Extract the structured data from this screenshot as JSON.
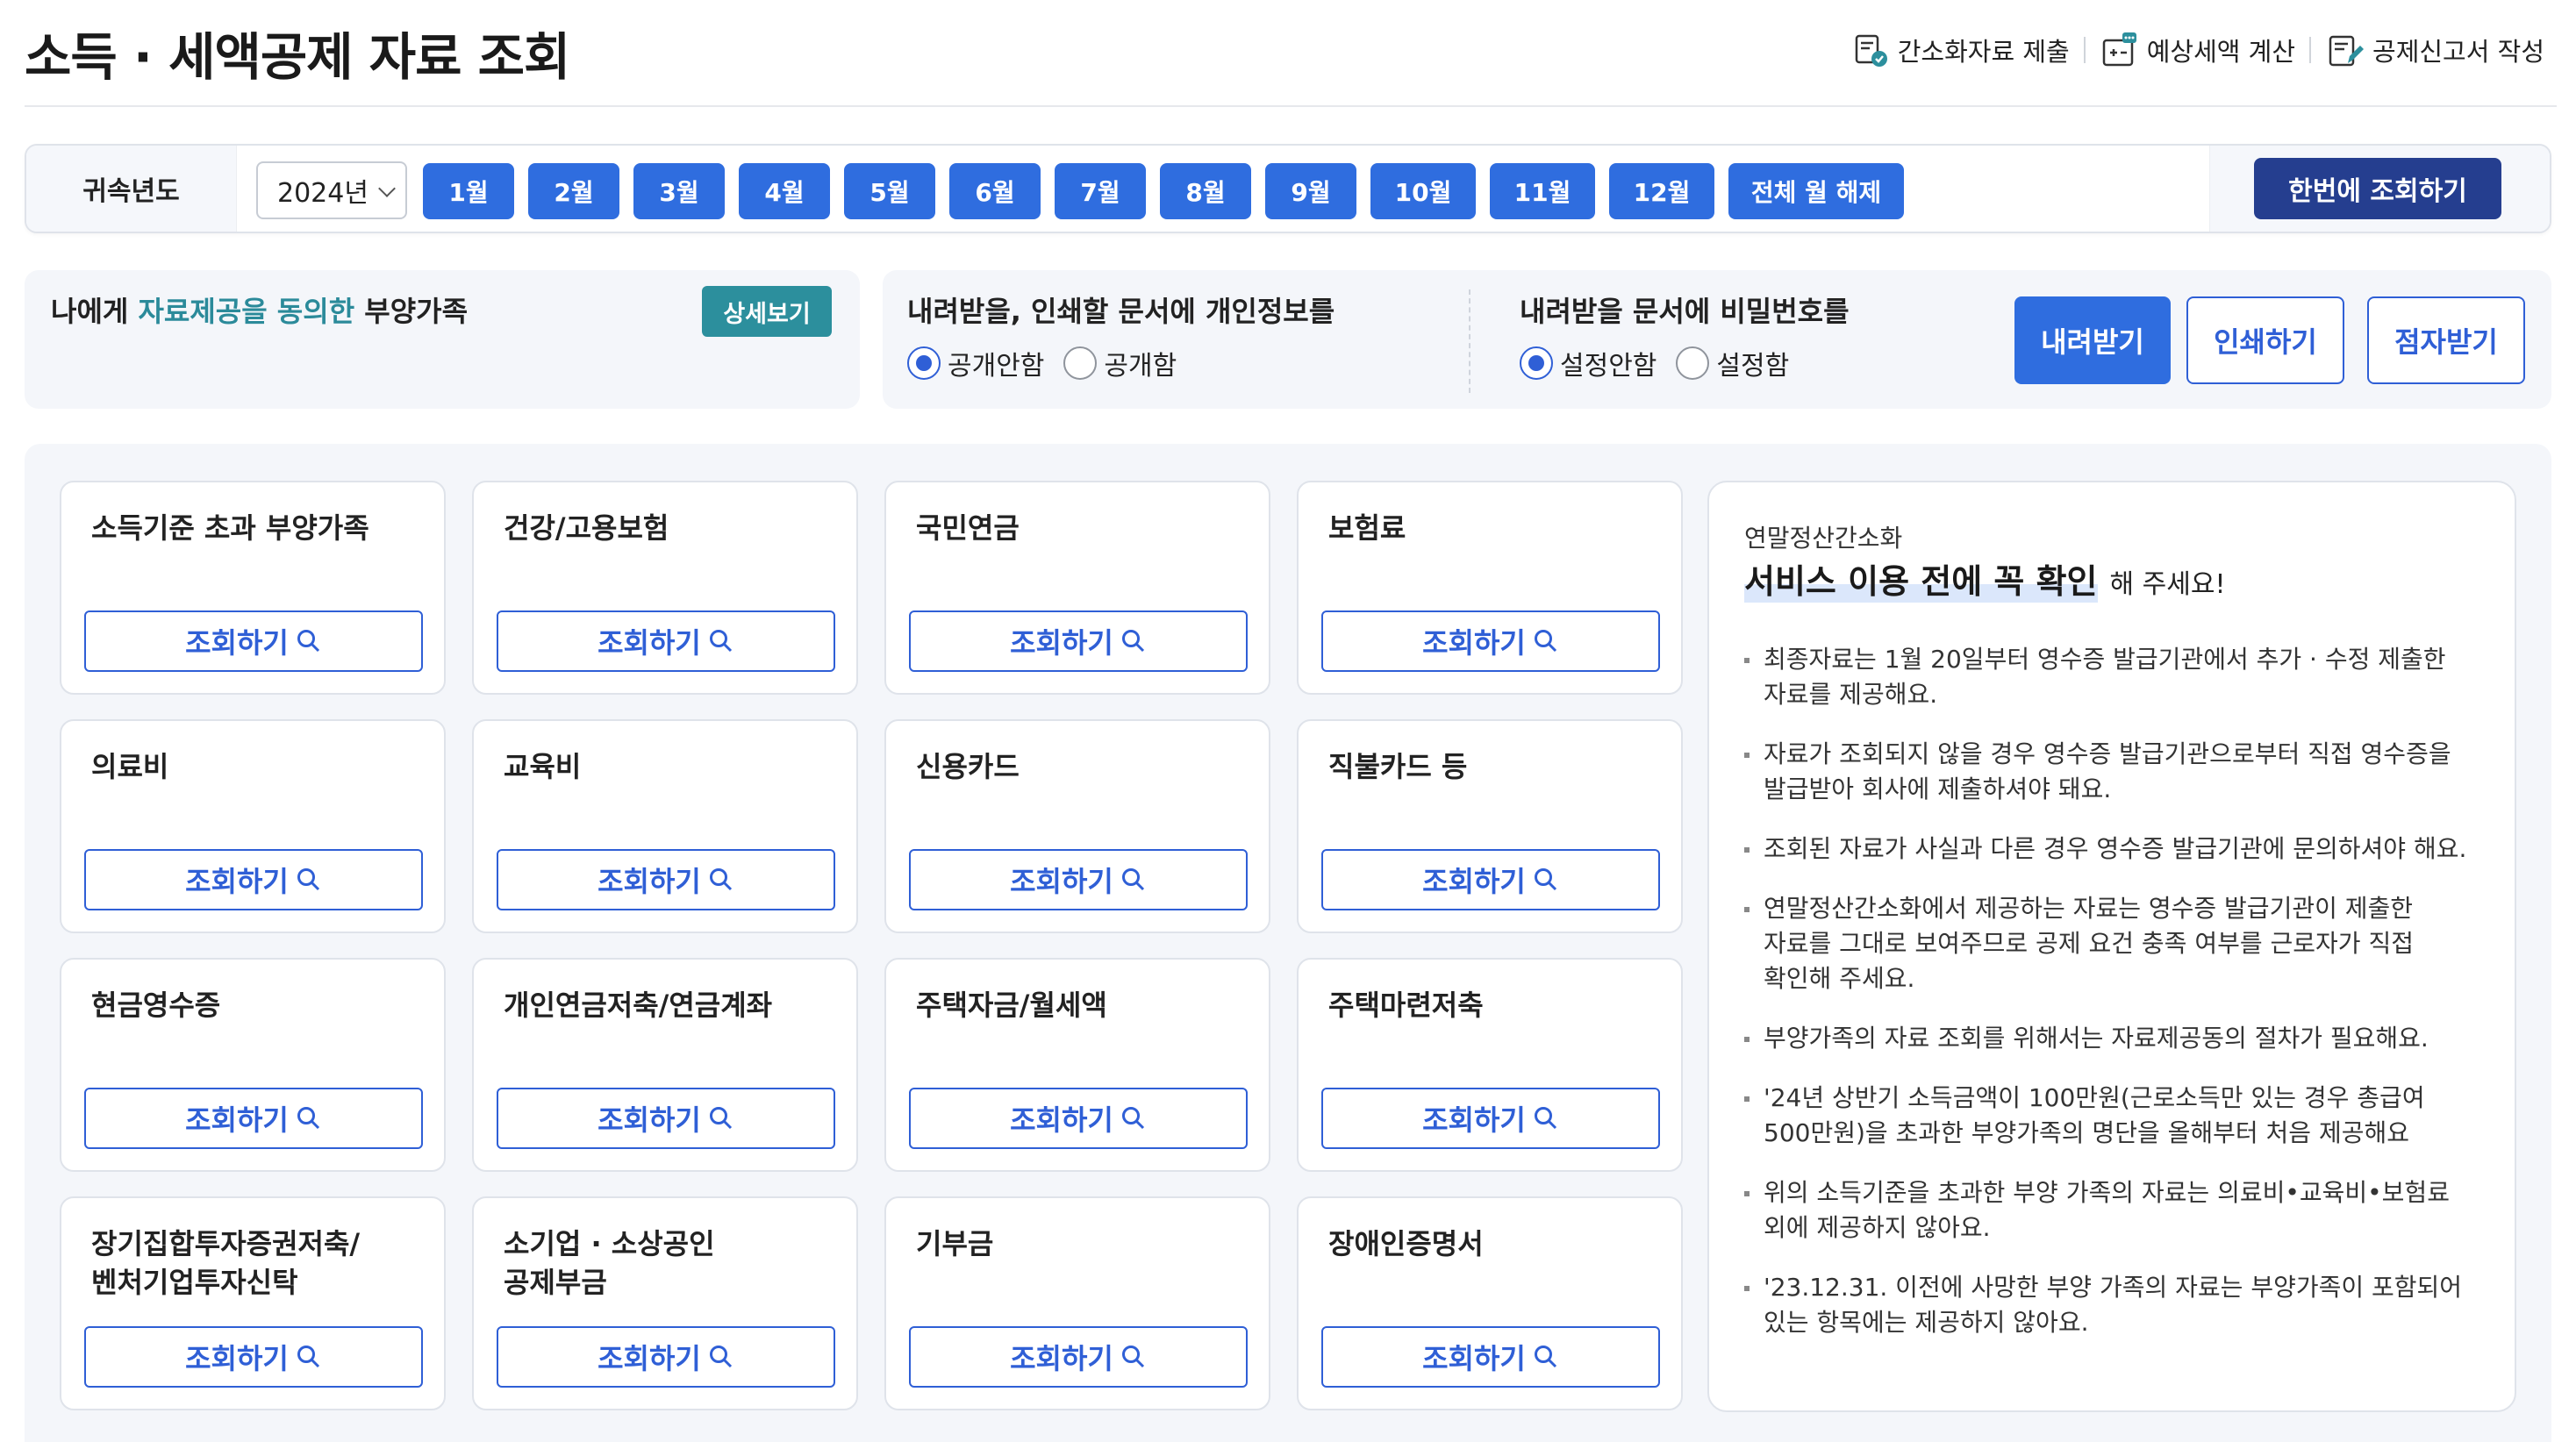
{
  "page": {
    "title": "소득 · 세액공제 자료 조회"
  },
  "header_actions": [
    {
      "label": "간소화자료 제출",
      "icon": "document-check-icon"
    },
    {
      "label": "예상세액 계산",
      "icon": "calculator-chat-icon"
    },
    {
      "label": "공제신고서 작성",
      "icon": "document-edit-icon"
    }
  ],
  "year_bar": {
    "label": "귀속년도",
    "year_value": "2024년",
    "months": [
      "1월",
      "2월",
      "3월",
      "4월",
      "5월",
      "6월",
      "7월",
      "8월",
      "9월",
      "10월",
      "11월",
      "12월"
    ],
    "clear_all_label": "전체 월 해제",
    "query_all_label": "한번에 조회하기"
  },
  "dependents": {
    "title_prefix": "나에게 ",
    "title_highlight": "자료제공을 동의한",
    "title_suffix": " 부양가족",
    "detail_label": "상세보기"
  },
  "options": {
    "personal_info": {
      "question": "내려받을, 인쇄할 문서에 개인정보를",
      "choices": [
        "공개안함",
        "공개함"
      ],
      "selected": 0
    },
    "password": {
      "question": "내려받을 문서에 비밀번호를",
      "choices": [
        "설정안함",
        "설정함"
      ],
      "selected": 0
    },
    "buttons": {
      "download": "내려받기",
      "print": "인쇄하기",
      "braille": "점자받기"
    }
  },
  "query_label": "조회하기",
  "cards": [
    "소득기준 초과 부양가족",
    "건강/고용보험",
    "국민연금",
    "보험료",
    "의료비",
    "교육비",
    "신용카드",
    "직불카드 등",
    "현금영수증",
    "개인연금저축/연금계좌",
    "주택자금/월세액",
    "주택마련저축",
    "장기집합투자증권저축/\n벤처기업투자신탁",
    "소기업 · 소상공인\n공제부금",
    "기부금",
    "장애인증명서"
  ],
  "info": {
    "subtitle": "연말정산간소화",
    "heading": "서비스 이용 전에 꼭 확인",
    "heading_tail": "해 주세요!",
    "items": [
      "최종자료는 1월 20일부터 영수증 발급기관에서 추가 · 수정 제출한\n자료를 제공해요.",
      "자료가 조회되지 않을 경우 영수증 발급기관으로부터 직접 영수증을\n발급받아 회사에 제출하셔야 돼요.",
      "조회된 자료가 사실과 다른 경우 영수증 발급기관에 문의하셔야 해요.",
      "연말정산간소화에서 제공하는 자료는 영수증 발급기관이 제출한\n자료를 그대로 보여주므로 공제 요건 충족 여부를 근로자가 직접\n확인해 주세요.",
      "부양가족의 자료 조회를 위해서는 자료제공동의 절차가 필요해요.",
      "'24년 상반기 소득금액이 100만원(근로소득만 있는 경우 총급여\n500만원)을 초과한 부양가족의 명단을 올해부터 처음 제공해요",
      "위의 소득기준을 초과한 부양 가족의 자료는 의료비•교육비•보험료\n외에 제공하지 않아요.",
      "'23.12.31. 이전에 사망한 부양 가족의 자료는 부양가족이 포함되어\n있는 항목에는 제공하지 않아요."
    ]
  },
  "colors": {
    "primary": "#2f6ddf",
    "dark_primary": "#253e8f",
    "teal": "#2c8f9d",
    "panel_bg": "#f4f6fa"
  }
}
